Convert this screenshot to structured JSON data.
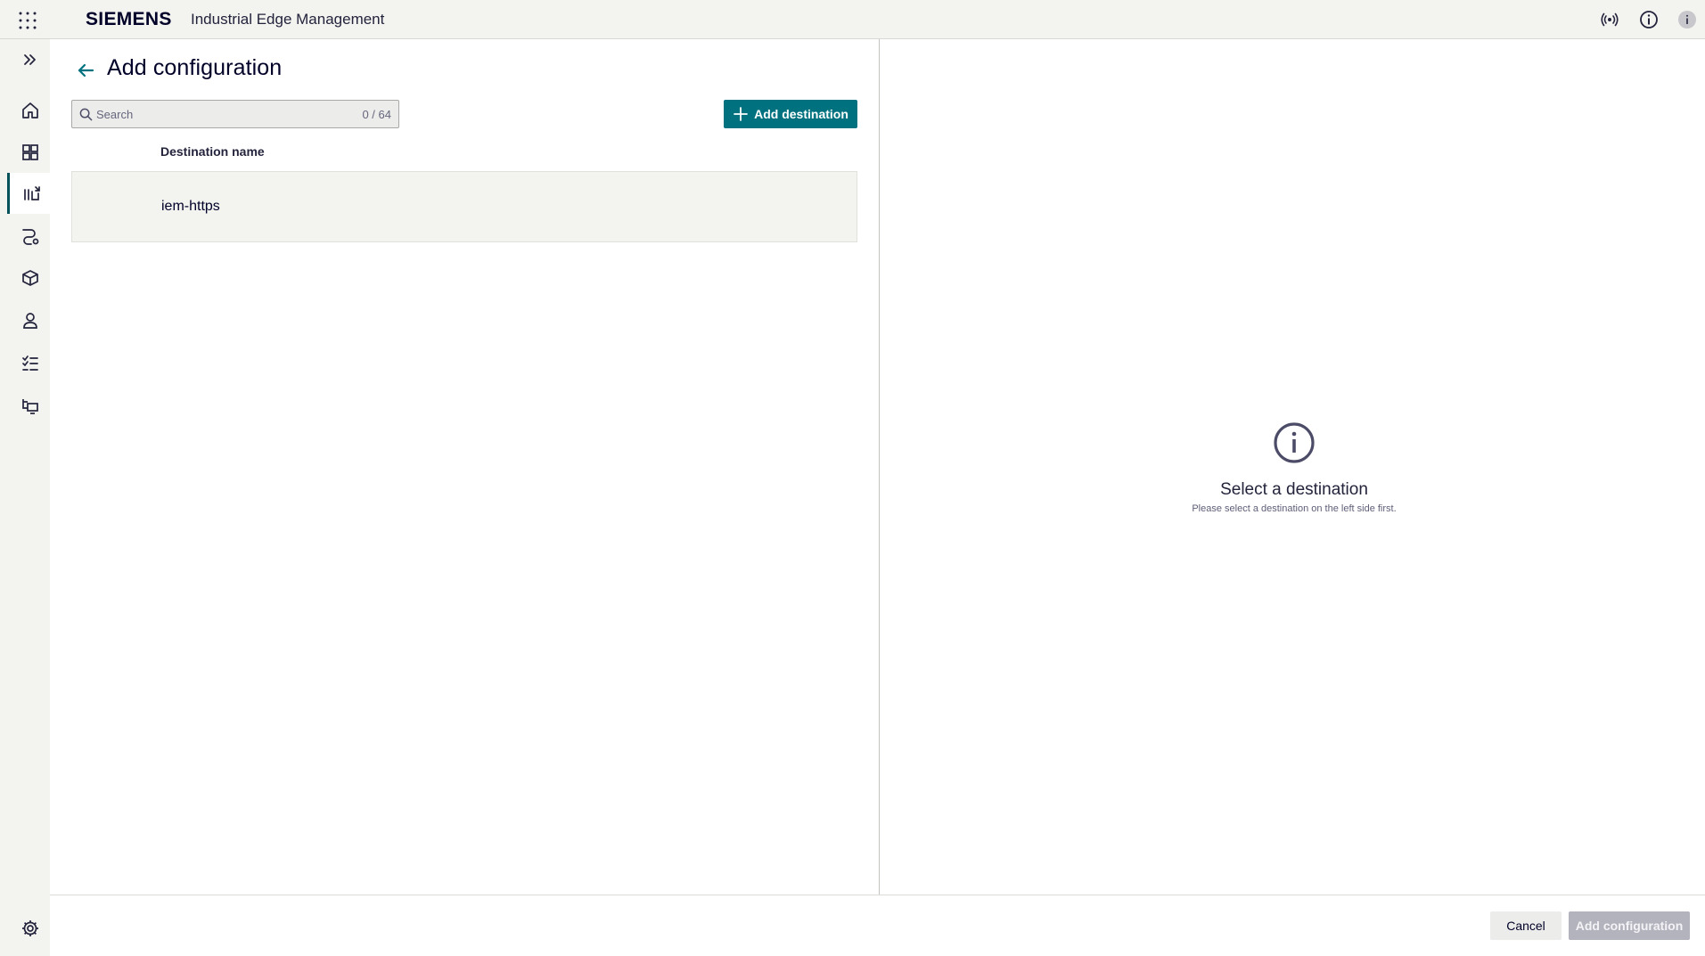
{
  "header": {
    "logo": "SIEMENS",
    "app_name": "Industrial Edge Management",
    "icons": [
      "app-launcher-icon",
      "connectivity-status-icon",
      "about-icon",
      "user-info-icon"
    ]
  },
  "sidebar": {
    "items": [
      {
        "icon": "expand-icon",
        "label": "Expand"
      },
      {
        "icon": "home-icon",
        "label": "Home"
      },
      {
        "icon": "dashboard-icon",
        "label": "Dashboard"
      },
      {
        "icon": "data-config-icon",
        "label": "Configurations",
        "active": true
      },
      {
        "icon": "flow-icon",
        "label": "Flows"
      },
      {
        "icon": "apps-cube-icon",
        "label": "Apps"
      },
      {
        "icon": "user-icon",
        "label": "Users"
      },
      {
        "icon": "tasks-icon",
        "label": "Tasks"
      },
      {
        "icon": "edge-devices-icon",
        "label": "Devices"
      },
      {
        "icon": "settings-icon",
        "label": "Settings"
      }
    ]
  },
  "main": {
    "title": "Add configuration",
    "search": {
      "placeholder": "Search",
      "value": "",
      "count": "0 / 64"
    },
    "add_destination_label": "Add destination",
    "table": {
      "columns": [
        "Destination name"
      ],
      "rows": [
        {
          "name": "iem-https"
        }
      ]
    }
  },
  "detail": {
    "icon": "info-circle-icon",
    "title": "Select a destination",
    "subtitle": "Please select a destination on the left side first."
  },
  "footer": {
    "cancel_label": "Cancel",
    "add_configuration_label": "Add configuration"
  },
  "colors": {
    "accent": "#00727f",
    "active_indicator": "#005159",
    "disabled_button": "#b3b3be",
    "shell_background": "#f3f3f0"
  }
}
